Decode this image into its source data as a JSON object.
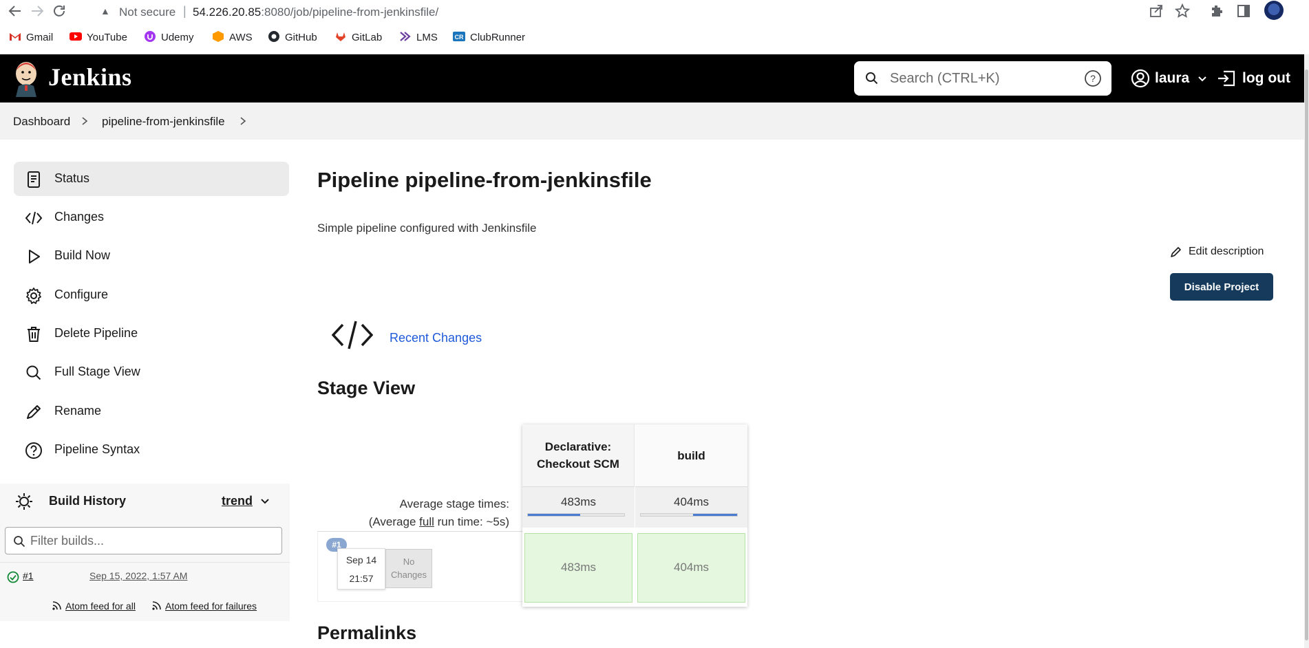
{
  "browser": {
    "security_label": "Not secure",
    "url_host": "54.226.20.85",
    "url_path": ":8080/job/pipeline-from-jenkinsfile/",
    "bookmarks": [
      {
        "label": "Gmail",
        "icon": "gmail-icon"
      },
      {
        "label": "YouTube",
        "icon": "youtube-icon"
      },
      {
        "label": "Udemy",
        "icon": "udemy-icon"
      },
      {
        "label": "AWS",
        "icon": "aws-icon"
      },
      {
        "label": "GitHub",
        "icon": "github-icon"
      },
      {
        "label": "GitLab",
        "icon": "gitlab-icon"
      },
      {
        "label": "LMS",
        "icon": "lms-icon"
      },
      {
        "label": "ClubRunner",
        "icon": "clubrunner-icon"
      }
    ]
  },
  "header": {
    "brand": "Jenkins",
    "search_placeholder": "Search (CTRL+K)",
    "username": "laura",
    "logout_label": "log out"
  },
  "breadcrumb": {
    "items": [
      "Dashboard",
      "pipeline-from-jenkinsfile"
    ]
  },
  "sidebar": {
    "items": [
      {
        "label": "Status",
        "icon": "document-icon",
        "active": true
      },
      {
        "label": "Changes",
        "icon": "code-icon"
      },
      {
        "label": "Build Now",
        "icon": "play-icon"
      },
      {
        "label": "Configure",
        "icon": "gear-icon"
      },
      {
        "label": "Delete Pipeline",
        "icon": "trash-icon"
      },
      {
        "label": "Full Stage View",
        "icon": "search-icon"
      },
      {
        "label": "Rename",
        "icon": "pencil-icon"
      },
      {
        "label": "Pipeline Syntax",
        "icon": "help-icon"
      }
    ]
  },
  "build_history": {
    "title": "Build History",
    "trend_label": "trend",
    "filter_placeholder": "Filter builds...",
    "builds": [
      {
        "number": "#1",
        "date": "Sep 15, 2022, 1:57 AM",
        "status": "success"
      }
    ],
    "feed_all": "Atom feed for all",
    "feed_failures": "Atom feed for failures"
  },
  "main": {
    "title": "Pipeline pipeline-from-jenkinsfile",
    "description": "Simple pipeline configured with Jenkinsfile",
    "edit_description": "Edit description",
    "disable_button": "Disable Project",
    "recent_changes": "Recent Changes",
    "stage_view_title": "Stage View",
    "permalinks_title": "Permalinks"
  },
  "stage_view": {
    "avg_label": "Average stage times:",
    "avg_run_prefix": "(Average ",
    "avg_run_full": "full",
    "avg_run_suffix": " run time: ~5s)",
    "stages": [
      {
        "name_line1": "Declarative:",
        "name_line2": "Checkout SCM",
        "avg": "483ms",
        "bar_fraction": 0.54
      },
      {
        "name_line1": "build",
        "name_line2": "",
        "avg": "404ms",
        "bar_fraction": 0.46
      }
    ],
    "runs": [
      {
        "badge": "#1",
        "date": "Sep 14",
        "time": "21:57",
        "changes_line1": "No",
        "changes_line2": "Changes",
        "cells": [
          "483ms",
          "404ms"
        ]
      }
    ]
  },
  "colors": {
    "header_bg": "#000000",
    "primary_button": "#153a5c",
    "link": "#1e5ad9",
    "stage_success": "#e5f8df",
    "progress": "#4a7bd0"
  }
}
